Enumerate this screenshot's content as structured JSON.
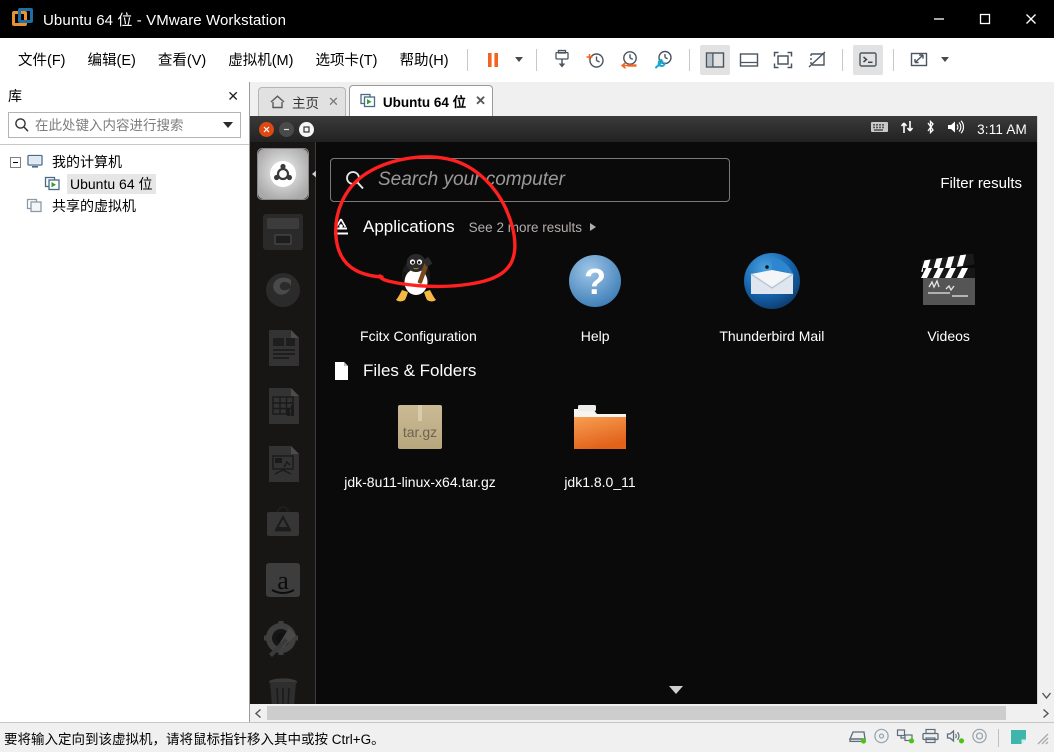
{
  "window": {
    "title": "Ubuntu 64 位 - VMware Workstation",
    "logo_icon": "vmware-logo-icon",
    "minimize_label": "最小化",
    "maximize_label": "最大化",
    "close_label": "关闭"
  },
  "menubar": {
    "items": [
      {
        "label": "文件(F)",
        "name": "menu-file"
      },
      {
        "label": "编辑(E)",
        "name": "menu-edit"
      },
      {
        "label": "查看(V)",
        "name": "menu-view"
      },
      {
        "label": "虚拟机(M)",
        "name": "menu-vm"
      },
      {
        "label": "选项卡(T)",
        "name": "menu-tabs"
      },
      {
        "label": "帮助(H)",
        "name": "menu-help"
      }
    ]
  },
  "toolbar": {
    "buttons": [
      {
        "icon": "pause-icon",
        "label": "挂起",
        "active": false
      },
      {
        "icon": "power-dropdown-caret-icon",
        "label": "电源菜单",
        "active": false
      },
      {
        "icon": "snapshot-manager-icon",
        "label": "管理快照",
        "active": false
      },
      {
        "icon": "take-snapshot-icon",
        "label": "创建快照",
        "active": false
      },
      {
        "icon": "revert-snapshot-icon",
        "label": "恢复快照",
        "active": false
      },
      {
        "icon": "snapshot-settings-icon",
        "label": "快照管理器",
        "active": false
      },
      {
        "icon": "show-library-panel-icon",
        "label": "显示或隐藏库",
        "active": true
      },
      {
        "icon": "show-thumbnail-bar-icon",
        "label": "显示或隐藏缩略图栏",
        "active": false
      },
      {
        "icon": "enter-fullscreen-icon",
        "label": "进入全屏",
        "active": false
      },
      {
        "icon": "unity-mode-icon",
        "label": "Unity 模式",
        "active": false
      },
      {
        "icon": "console-view-icon",
        "label": "控制台视图",
        "active": true
      },
      {
        "icon": "stretch-guest-icon",
        "label": "拉伸客户机",
        "active": false
      },
      {
        "icon": "stretch-dropdown-caret-icon",
        "label": "拉伸菜单",
        "active": false
      }
    ]
  },
  "library": {
    "title": "库",
    "close_icon": "close-icon",
    "search": {
      "icon": "search-icon",
      "placeholder": "在此处键入内容进行搜索",
      "value": "",
      "dropdown_icon": "chevron-down-icon"
    },
    "tree": [
      {
        "label": "我的计算机",
        "icon": "computer-icon",
        "level": 0,
        "expanded": true,
        "selected": false
      },
      {
        "label": "Ubuntu 64 位",
        "icon": "vm-running-icon",
        "level": 1,
        "expanded": false,
        "selected": true
      },
      {
        "label": "共享的虚拟机",
        "icon": "shared-vms-icon",
        "level": 0,
        "expanded": false,
        "selected": false
      }
    ]
  },
  "tabs": [
    {
      "label": "主页",
      "icon": "home-icon",
      "active": false,
      "close_icon": "close-icon"
    },
    {
      "label": "Ubuntu 64 位",
      "icon": "vm-running-icon",
      "active": true,
      "close_icon": "close-icon"
    }
  ],
  "guest": {
    "panel": {
      "window_controls": [
        "close-button",
        "minimize-button",
        "maximize-button"
      ],
      "indicators": [
        {
          "icon": "keyboard-indicator-icon",
          "name": "keyboard-indicator"
        },
        {
          "icon": "network-indicator-icon",
          "name": "network-indicator"
        },
        {
          "icon": "bluetooth-indicator-icon",
          "name": "bluetooth-indicator"
        },
        {
          "icon": "volume-indicator-icon",
          "name": "volume-indicator"
        }
      ],
      "clock": "3:11 AM"
    },
    "launcher": [
      {
        "name": "launcher-dash-home",
        "icon": "ubuntu-dash-icon",
        "selected": true
      },
      {
        "name": "launcher-files",
        "icon": "files-nautilus-icon",
        "selected": false
      },
      {
        "name": "launcher-firefox",
        "icon": "firefox-icon",
        "selected": false
      },
      {
        "name": "launcher-libreoffice-writer",
        "icon": "libreoffice-writer-icon",
        "selected": false
      },
      {
        "name": "launcher-libreoffice-calc",
        "icon": "libreoffice-calc-icon",
        "selected": false
      },
      {
        "name": "launcher-libreoffice-impress",
        "icon": "libreoffice-impress-icon",
        "selected": false
      },
      {
        "name": "launcher-software-center",
        "icon": "ubuntu-software-center-icon",
        "selected": false
      },
      {
        "name": "launcher-amazon",
        "icon": "amazon-icon",
        "selected": false
      },
      {
        "name": "launcher-system-settings",
        "icon": "system-settings-icon",
        "selected": false
      },
      {
        "name": "launcher-trash",
        "icon": "trash-icon",
        "selected": false
      }
    ],
    "dash": {
      "search": {
        "icon": "search-icon",
        "placeholder": "Search your computer",
        "value": ""
      },
      "filter_results_label": "Filter results",
      "sections": [
        {
          "name": "applications",
          "title": "Applications",
          "icon": "applications-lens-icon",
          "more_label": "See 2 more results",
          "more_chevron": "chevron-right-icon",
          "results": [
            {
              "label": "Fcitx Configuration",
              "icon": "fcitx-tux-icon",
              "annotated": true
            },
            {
              "label": "Help",
              "icon": "help-question-icon",
              "annotated": false
            },
            {
              "label": "Thunderbird Mail",
              "icon": "thunderbird-icon",
              "annotated": false
            },
            {
              "label": "Videos",
              "icon": "videos-clapperboard-icon",
              "annotated": false
            }
          ]
        },
        {
          "name": "files-and-folders",
          "title": "Files & Folders",
          "icon": "file-document-icon",
          "more_label": "",
          "results": [
            {
              "label": "jdk-8u11-linux-x64.tar.gz",
              "icon": "targz-archive-icon",
              "annotated": false
            },
            {
              "label": "jdk1.8.0_11",
              "icon": "folder-icon",
              "annotated": false
            }
          ]
        }
      ],
      "scroll_down_icon": "chevron-down-icon"
    },
    "annotation": {
      "shape": "hand-drawn-circle",
      "color": "#ff2020",
      "target": "Fcitx Configuration"
    }
  },
  "scrollbars": {
    "h_left_icon": "chevron-left-icon",
    "h_right_icon": "chevron-right-icon",
    "v_down_icon": "chevron-down-icon"
  },
  "statusbar": {
    "message": "要将输入定向到该虚拟机，请将鼠标指针移入其中或按 Ctrl+G。",
    "devices": [
      {
        "icon": "hard-disk-icon",
        "name": "status-hard-disk",
        "connected": true
      },
      {
        "icon": "cd-dvd-icon",
        "name": "status-cd-dvd",
        "connected": false
      },
      {
        "icon": "network-adapter-icon",
        "name": "status-network",
        "connected": true
      },
      {
        "icon": "printer-icon",
        "name": "status-printer",
        "connected": false
      },
      {
        "icon": "sound-card-icon",
        "name": "status-sound",
        "connected": true
      },
      {
        "icon": "camera-icon",
        "name": "status-camera",
        "connected": false
      },
      {
        "icon": "usb-note-icon",
        "name": "status-usb",
        "connected": false
      }
    ],
    "resize_grip_icon": "resize-grip-icon"
  },
  "colors": {
    "accent_orange": "#dd4814",
    "vmware_orange": "#f26422",
    "annotation_red": "#ff2020",
    "dash_bg": "#0b0a0a",
    "title_bg": "#000000"
  }
}
